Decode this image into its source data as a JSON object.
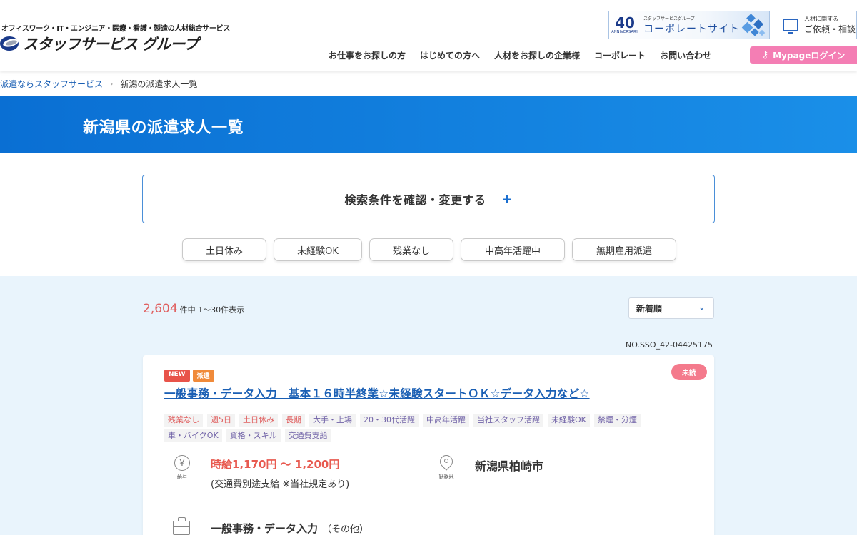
{
  "header": {
    "tagline": "オフィスワーク・IT・エンジニア・医療・看護・製造の人材総合サービス",
    "logo_text": "スタッフサービス グループ",
    "corp_banner": {
      "anniversary_num": "40",
      "anniversary_sub": "ANNIVERSARY",
      "small": "スタッフサービスグループ",
      "main": "コーポレートサイト"
    },
    "request": {
      "small": "人材に関する",
      "main": "ご依頼・相談"
    },
    "nav": [
      "お仕事をお探しの方",
      "はじめての方へ",
      "人材をお探しの企業様",
      "コーポレート",
      "お問い合わせ"
    ],
    "mypage_label": "Mypageログイン"
  },
  "breadcrumb": {
    "home": "派遣ならスタッフサービス",
    "sep": "›",
    "current": "新潟の派遣求人一覧"
  },
  "hero": {
    "title": "新潟県の派遣求人一覧"
  },
  "search": {
    "label": "検索条件を確認・変更する",
    "plus": "+"
  },
  "chips": [
    "土日休み",
    "未経験OK",
    "残業なし",
    "中高年活躍中",
    "無期雇用派遣"
  ],
  "results": {
    "count": "2,604",
    "count_text": "件中 1〜30件表示",
    "sort_value": "新着順",
    "job_no": "NO.SSO_42-04425175"
  },
  "job": {
    "badges": [
      "NEW",
      "派遣"
    ],
    "unread": "未読",
    "title": "一般事務・データ入力　基本１６時半終業☆未経験スタートＯＫ☆データ入力など☆",
    "tags": [
      {
        "label": "残業なし",
        "color": "red"
      },
      {
        "label": "週5日",
        "color": "red"
      },
      {
        "label": "土日休み",
        "color": "red"
      },
      {
        "label": "長期",
        "color": "red"
      },
      {
        "label": "大手・上場",
        "color": "purple"
      },
      {
        "label": "20・30代活躍",
        "color": "purple"
      },
      {
        "label": "中高年活躍",
        "color": "purple"
      },
      {
        "label": "当社スタッフ活躍",
        "color": "purple"
      },
      {
        "label": "未経験OK",
        "color": "purple"
      },
      {
        "label": "禁煙・分煙",
        "color": "purple"
      },
      {
        "label": "車・バイクOK",
        "color": "purple"
      },
      {
        "label": "資格・スキル",
        "color": "purple"
      },
      {
        "label": "交通費支給",
        "color": "purple"
      }
    ],
    "salary_caption": "給与",
    "salary": "時給1,170円 〜 1,200円",
    "salary_note": "(交通費別途支給 ※当社規定あり)",
    "location_caption": "勤務地",
    "location": "新潟県柏崎市",
    "occupation": "一般事務・データ入力",
    "occupation_sub": "（その他）"
  },
  "colors": {
    "accent": "#0a6fd3",
    "pink": "#f47eb4",
    "price_red": "#e85a50",
    "results_bg": "#e9f4fc"
  }
}
